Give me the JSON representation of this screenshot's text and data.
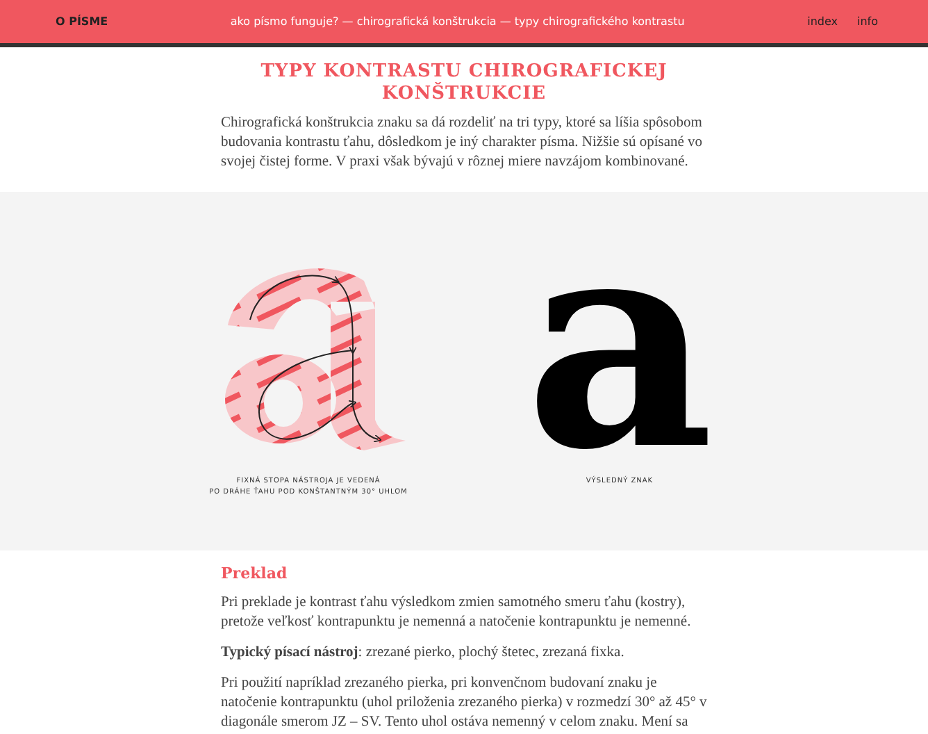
{
  "header": {
    "brand": "O PÍSME",
    "breadcrumb": "ako písmo funguje? — chirografická konštrukcia — typy chirografického kontrastu",
    "nav": [
      "index",
      "info"
    ]
  },
  "title": "TYPY KONTRASTU CHIROGRAFICKEJ KONŠTRUKCIE",
  "intro": "Chirografická konštrukcia znaku sa dá rozdeliť na tri typy, ktoré sa líšia spôsobom budovania kontrastu ťahu, dôsledkom je iný charakter písma. Nižšie sú opísané vo svojej čistej forme. V praxi však bývajú v rôznej miere navzájom kombinované.",
  "figures": [
    {
      "kind": "construction",
      "caption_lines": [
        "FIXNÁ STOPA NÁSTROJA JE VEDENÁ",
        "PO DRÁHE ŤAHU POD KONŠTANTNÝM 30° UHLOM"
      ]
    },
    {
      "kind": "result",
      "glyph": "a",
      "caption_lines": [
        "VÝSLEDNÝ ZNAK"
      ]
    }
  ],
  "section": {
    "heading": "Preklad",
    "paragraphs": [
      "Pri preklade je kontrast ťahu výsledkom zmien samotného smeru ťahu (kostry), pretože veľkosť kontrapunktu je nemenná a natočenie kontrapunktu je nemenné.",
      "**Typický písací nástroj**: zrezané pierko, plochý štetec, zrezaná fixka.",
      "Pri použití napríklad zrezaného pierka, pri konvenčnom budovaní znaku je natočenie kontrapunktu (uhol priloženia zrezaného pierka) v rozmedzí 30° až 45° v diagonále smerom JZ – SV. Tento uhol ostáva nemenný v celom znaku. Mení sa"
    ]
  }
}
